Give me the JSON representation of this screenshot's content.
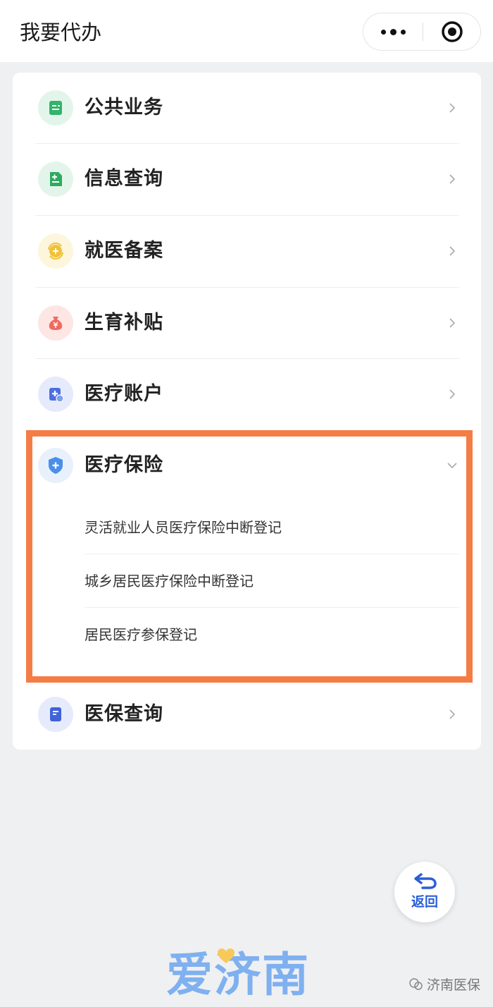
{
  "header": {
    "title": "我要代办"
  },
  "menu": [
    {
      "label": "公共业务",
      "icon": "document-icon",
      "icon_color": "#34b36a",
      "icon_bg": "#e3f5ea"
    },
    {
      "label": "信息查询",
      "icon": "medical-record-icon",
      "icon_color": "#2faa5f",
      "icon_bg": "#e3f5ea"
    },
    {
      "label": "就医备案",
      "icon": "sync-circle-icon",
      "icon_color": "#f2c13a",
      "icon_bg": "#fdf6dd"
    },
    {
      "label": "生育补贴",
      "icon": "money-bag-icon",
      "icon_color": "#ee6b61",
      "icon_bg": "#fde6e4"
    },
    {
      "label": "医疗账户",
      "icon": "medical-account-icon",
      "icon_color": "#4b6fe0",
      "icon_bg": "#e6ebfb"
    },
    {
      "label": "医疗保险",
      "icon": "shield-plus-icon",
      "icon_color": "#4a8eea",
      "icon_bg": "#e8f0fc",
      "expanded": true
    },
    {
      "label": "医保查询",
      "icon": "notebook-icon",
      "icon_color": "#3f63d8",
      "icon_bg": "#e6ebfb"
    }
  ],
  "insurance_sub_items": [
    {
      "label": "灵活就业人员医疗保险中断登记"
    },
    {
      "label": "城乡居民医疗保险中断登记"
    },
    {
      "label": "居民医疗参保登记"
    }
  ],
  "back_button": {
    "label": "返回"
  },
  "footer": {
    "logo_text": "爱济南",
    "watermark": "济南医保"
  },
  "colors": {
    "highlight_border": "#f47d45",
    "accent_blue": "#2a5fd6"
  }
}
